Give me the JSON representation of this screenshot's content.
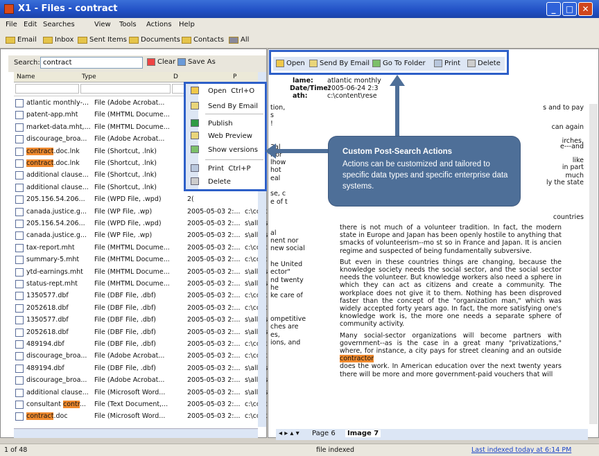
{
  "window": {
    "title": "X1 - Files - contract"
  },
  "menu": [
    "File",
    "Edit",
    "Searches",
    "View",
    "Tools",
    "Actions",
    "Help"
  ],
  "quick_bar": [
    "Email",
    "Inbox",
    "Sent Items",
    "Documents",
    "Contacts",
    "All"
  ],
  "search": {
    "label": "Search:",
    "value": "contract",
    "clear_label": "Clear",
    "save_as_label": "Save As"
  },
  "columns": {
    "name": "Name",
    "type": "Type",
    "date": "D",
    "path": "P"
  },
  "rows": [
    {
      "name": "atlantic monthly-...",
      "type": "File (Adobe Acrobat...",
      "date": "2(",
      "path": ""
    },
    {
      "name": "patent-app.mht",
      "type": "File (MHTML Docume...",
      "date": "2(",
      "path": ""
    },
    {
      "name": "market-data.mht,...",
      "type": "File (MHTML Docume...",
      "date": "2(",
      "path": ""
    },
    {
      "name": "discourage_broa...",
      "type": "File (Adobe Acrobat...",
      "date": "2(",
      "path": ""
    },
    {
      "name_hl": "contract",
      "name_rest": ".doc.lnk",
      "type": "File (Shortcut, .lnk)",
      "date": "2(",
      "path": ""
    },
    {
      "name_hl": "contract",
      "name_rest": ".doc.lnk",
      "type": "File (Shortcut, .lnk)",
      "date": "2(",
      "path": ""
    },
    {
      "name": "additional clause...",
      "type": "File (Shortcut, .lnk)",
      "date": "2(",
      "path": ""
    },
    {
      "name": "additional clause...",
      "type": "File (Shortcut, .lnk)",
      "date": "2(",
      "path": ""
    },
    {
      "name": "205.156.54.206...",
      "type": "File (WPD File, .wpd)",
      "date": "2(",
      "path": ""
    },
    {
      "name": "canada.justice.g...",
      "type": "File (WP File, .wp)",
      "date": "2005-05-03 2:...",
      "path": "c:\\cont"
    },
    {
      "name": "205.156.54.206...",
      "type": "File (WPD File, .wpd)",
      "date": "2005-05-03 2:...",
      "path": "s\\all us"
    },
    {
      "name": "canada.justice.g...",
      "type": "File (WP File, .wp)",
      "date": "2005-05-03 2:...",
      "path": "s\\all us"
    },
    {
      "name": "tax-report.mht",
      "type": "File (MHTML Docume...",
      "date": "2005-05-03 2:...",
      "path": "c:\\cont"
    },
    {
      "name": "summary-5.mht",
      "type": "File (MHTML Docume...",
      "date": "2005-05-03 2:...",
      "path": "c:\\cont"
    },
    {
      "name": "ytd-earnings.mht",
      "type": "File (MHTML Docume...",
      "date": "2005-05-03 2:...",
      "path": "s\\all us"
    },
    {
      "name": "status-rept.mht",
      "type": "File (MHTML Docume...",
      "date": "2005-05-03 2:...",
      "path": "s\\all us"
    },
    {
      "name": "1350577.dbf",
      "type": "File (DBF File, .dbf)",
      "date": "2005-05-03 2:...",
      "path": "c:\\cont"
    },
    {
      "name": "2052618.dbf",
      "type": "File (DBF File, .dbf)",
      "date": "2005-05-03 2:...",
      "path": "c:\\cont"
    },
    {
      "name": "1350577.dbf",
      "type": "File (DBF File, .dbf)",
      "date": "2005-05-03 2:...",
      "path": "s\\all us"
    },
    {
      "name": "2052618.dbf",
      "type": "File (DBF File, .dbf)",
      "date": "2005-05-03 2:...",
      "path": "s\\all us"
    },
    {
      "name": "489194.dbf",
      "type": "File (DBF File, .dbf)",
      "date": "2005-05-03 2:...",
      "path": "c:\\cont"
    },
    {
      "name": "discourage_broa...",
      "type": "File (Adobe Acrobat...",
      "date": "2005-05-03 2:...",
      "path": "c:\\cont"
    },
    {
      "name": "489194.dbf",
      "type": "File (DBF File, .dbf)",
      "date": "2005-05-03 2:...",
      "path": "s\\all us"
    },
    {
      "name": "discourage_broa...",
      "type": "File (Adobe Acrobat...",
      "date": "2005-05-03 2:...",
      "path": "s\\all us"
    },
    {
      "name": "additional clause...",
      "type": "File (Microsoft Word...",
      "date": "2005-05-03 2:...",
      "path": "s\\all us"
    },
    {
      "name_pre": "consultant ",
      "name_hl": "contr",
      "name_rest": "...",
      "type": "File (Text Document,...",
      "date": "2005-05-03 2:...",
      "path": "c:\\cont"
    },
    {
      "name_hl": "contract",
      "name_rest": ".doc",
      "type": "File (Microsoft Word...",
      "date": "2005-05-03 2:...",
      "path": "c:\\cont"
    }
  ],
  "context_menu": {
    "items": [
      "Open",
      "Send By Email",
      "Publish",
      "Web Preview",
      "Show versions",
      "Print",
      "Delete"
    ],
    "shortcuts": {
      "open": "Ctrl+O",
      "print": "Ctrl+P"
    }
  },
  "doc_toolbar": [
    "Open",
    "Send By Email",
    "Go To Folder",
    "Print",
    "Delete"
  ],
  "meta": {
    "name_label": "lame:",
    "name_value": "atlantic monthly",
    "date_label": "Date/Time:",
    "date_value": "2005-06-24 2:3",
    "path_label": "ath:",
    "path_value": "c:\\content\\rese"
  },
  "doc_left_fragments": [
    "tion,",
    "s",
    "!",
    "",
    "",
    "3al",
    "Nor",
    "lhow",
    "hot",
    "eal",
    "",
    "se, c",
    "e of t",
    "",
    "",
    "",
    "al",
    "nent  nor",
    "new social",
    "",
    "he United",
    "ector\"",
    "nd  twenty",
    "he",
    "ke care of",
    "",
    "",
    "ompetitive",
    "ches  are",
    "es,",
    "ions,  and"
  ],
  "doc_right_fragments": [
    "s and to pay",
    "can again",
    "irches,",
    "e---and",
    "like",
    "in part",
    "much",
    "ly the state",
    "countries"
  ],
  "doc_paragraphs": [
    "there is not much of a volunteer tradition. In fact, the modern state in Europe and Japan has been openly hostile to anything that smacks of volunteerism--mo st so in France and Japan. It is ancien regime and suspected of being fundamentally subversive.",
    "But even in these countries things are changing, because the knowledge society needs the social sector, and the social sector needs the volunteer. But knowledge workers also need a sphere in which they can act as citizens and create a community. The workplace does not give it to them. Nothing has been disproved faster than the concept of the \"organization man,\" which was widely accepted forty years ago. In fact, the more satisfying one's knowledge work is, the more one needs a separate sphere of community activity.",
    "Many social-sector organizations will become partners with government--as is the case in a great many \"privatizations,\" where, for instance, a city pays for street cleaning and an outside ",
    "does the work. In American education over the next twenty years there will be more and more government-paid vouchers that will"
  ],
  "doc_highlight": "contractor",
  "tabs": [
    "Page 6",
    "Image 7"
  ],
  "callout": {
    "title": "Custom Post-Search Actions",
    "body": "Actions can be customized and tailored to specific data types and specific enterprise data systems."
  },
  "status": {
    "count": "1 of 48",
    "indexed": "file indexed",
    "last_indexed": "Last indexed today at 6:14 PM"
  },
  "colors": {
    "accent": "#2d5fc8",
    "callout": "#4e6f98",
    "highlight": "#f08a2e"
  }
}
